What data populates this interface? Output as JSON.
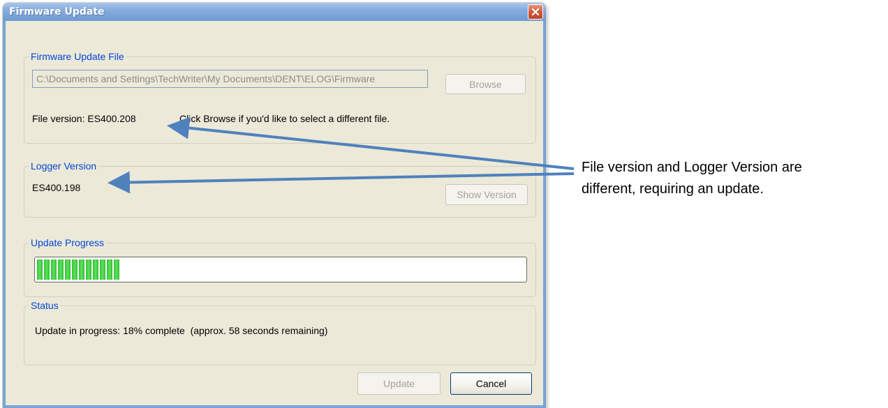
{
  "window": {
    "title": "Firmware Update"
  },
  "firmware_file": {
    "legend": "Firmware Update File",
    "path_value": "C:\\Documents and Settings\\TechWriter\\My Documents\\DENT\\ELOG\\Firmware",
    "browse_label": "Browse",
    "file_version_text": "File version: ES400.208",
    "hint_text": "Click Browse if you'd like to select a different file."
  },
  "logger": {
    "legend": "Logger Version",
    "version_text": "ES400.198",
    "show_version_label": "Show Version"
  },
  "progress": {
    "legend": "Update Progress",
    "percent": 18
  },
  "status": {
    "legend": "Status",
    "text": "Update in progress: 18% complete  (approx. 58 seconds remaining)"
  },
  "footer": {
    "update_label": "Update",
    "cancel_label": "Cancel"
  },
  "annotation": {
    "line1": "File version and Logger Version are",
    "line2": "different, requiring an update."
  },
  "colors": {
    "titlebar": "#7aa3d7",
    "legend_text": "#0046d5",
    "progress_green": "#31c431",
    "arrow": "#4f81bd"
  }
}
